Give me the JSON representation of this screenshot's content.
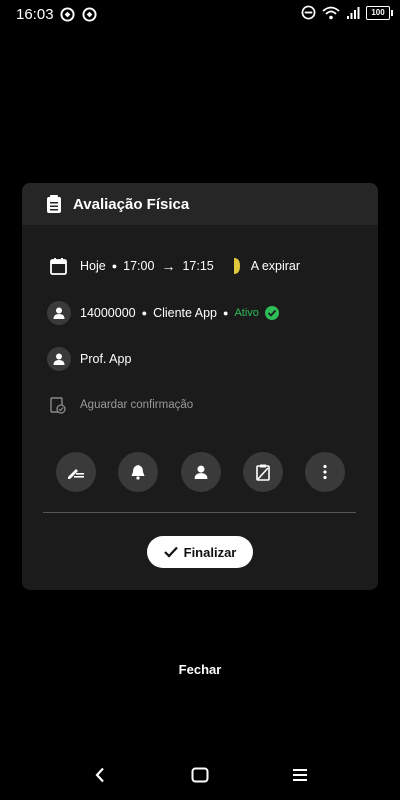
{
  "status_bar": {
    "time": "16:03",
    "battery": "100"
  },
  "modal": {
    "title": "Avaliação Física",
    "schedule": {
      "day": "Hoje",
      "start": "17:00",
      "end": "17:15",
      "status": "A expirar"
    },
    "client": {
      "id": "14000000",
      "name": "Cliente App",
      "status": "Ativo"
    },
    "professional": {
      "name": "Prof. App"
    },
    "confirmation": "Aguardar confirmação",
    "finalize_label": "Finalizar"
  },
  "close_label": "Fechar",
  "colors": {
    "accent_green": "#2ebd59",
    "expire_yellow": "#e0c93a",
    "card_bg": "#1b1b1b",
    "header_bg": "#262626"
  }
}
